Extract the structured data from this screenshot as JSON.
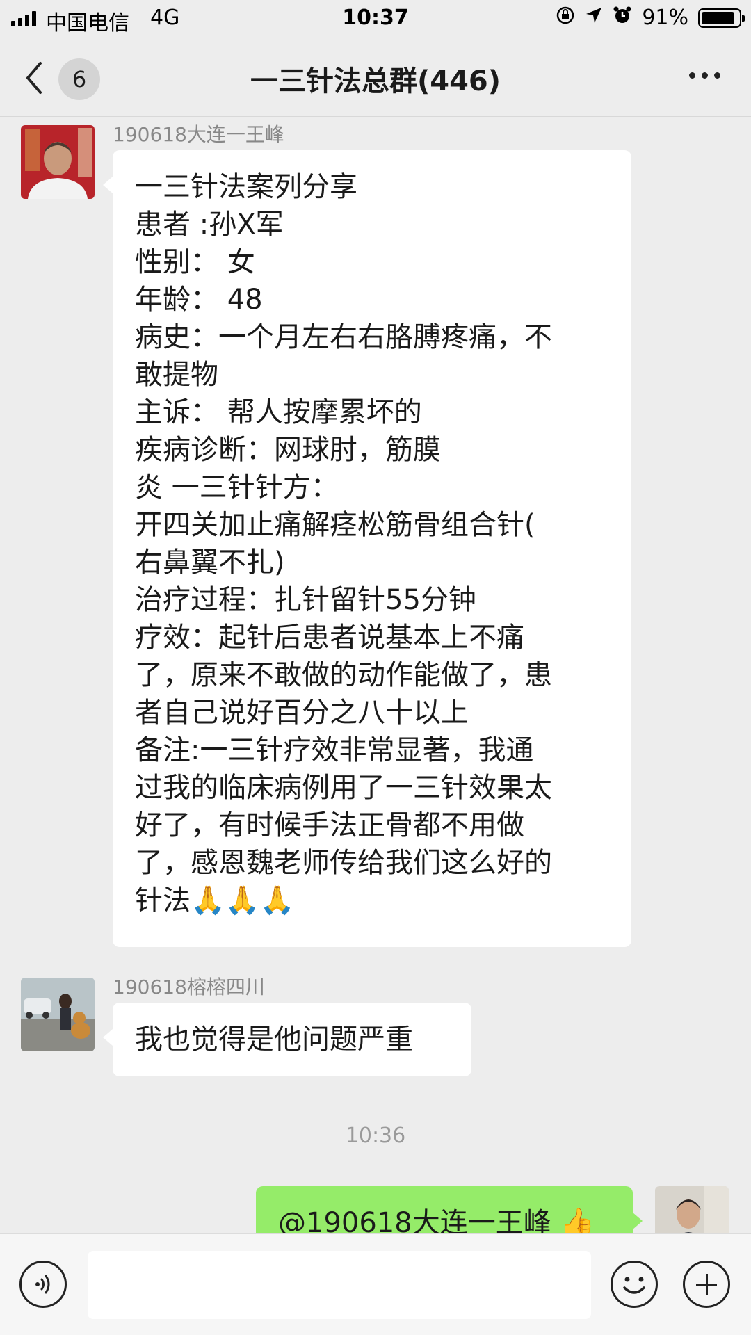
{
  "status_bar": {
    "carrier": "中国电信",
    "network": "4G",
    "time": "10:37",
    "battery_text": "91%",
    "battery_level": 0.91
  },
  "nav": {
    "back_count": "6",
    "title": "一三针法总群(446)"
  },
  "messages": [
    {
      "sender": "190618大连一王峰",
      "lines": [
        "一三针法案列分享",
        "患者 :孙X军",
        "性别： 女",
        "年龄： 48",
        "病史：一个月左右右胳膊疼痛，不",
        "敢提物",
        "主诉：  帮人按摩累坏的",
        "             疾病诊断：网球肘，筋膜",
        "炎                            一三针针方：",
        "开四关加止痛解痉松筋骨组合针(",
        "右鼻翼不扎)",
        "治疗过程：扎针留针55分钟",
        "疗效：起针后患者说基本上不痛",
        "了，原来不敢做的动作能做了，患",
        "者自己说好百分之八十以上",
        "备注:一三针疗效非常显著，我通",
        "过我的临床病例用了一三针效果太",
        "好了，有时候手法正骨都不用做",
        "了，感恩魏老师传给我们这么好的",
        "针法🙏🙏🙏"
      ]
    },
    {
      "sender": "190618榕榕四川",
      "lines": [
        "我也觉得是他问题严重"
      ]
    }
  ],
  "timestamp": "10:36",
  "outgoing": {
    "text": "@190618大连一王峰 👍"
  },
  "colors": {
    "background": "#ededed",
    "outgoing_bubble": "#95ec69",
    "incoming_bubble": "#ffffff"
  }
}
